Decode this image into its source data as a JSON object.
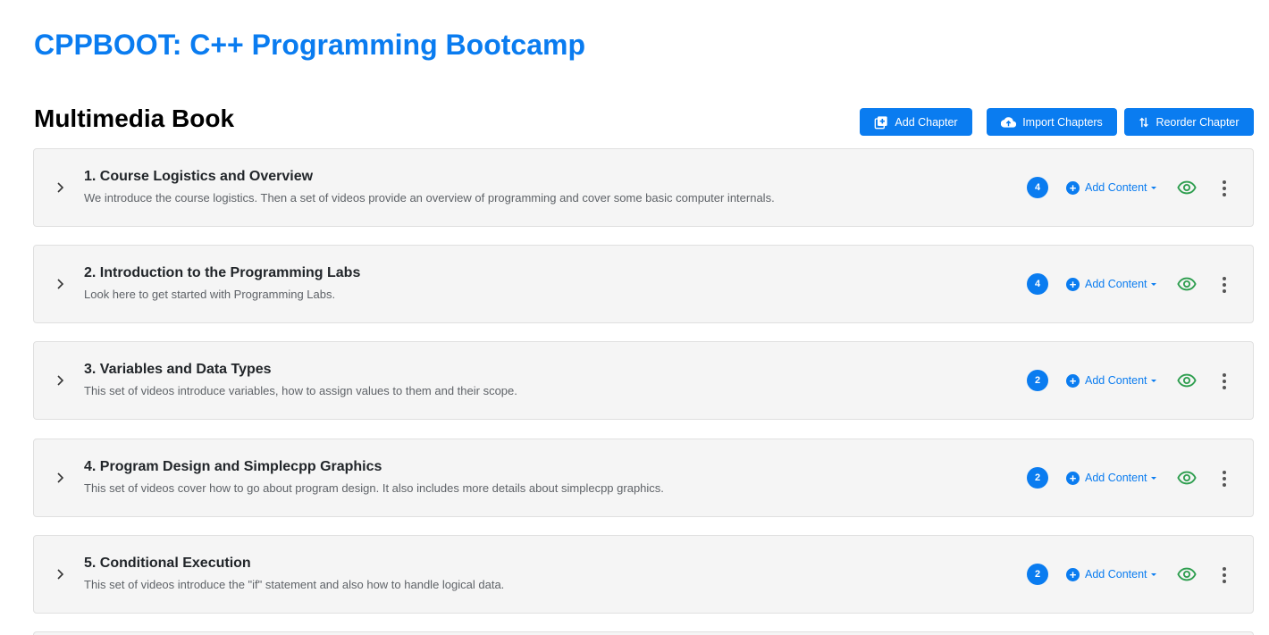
{
  "course": {
    "title": "CPPBOOT: C++ Programming Bootcamp"
  },
  "book": {
    "title": "Multimedia Book"
  },
  "toolbar": {
    "add_chapter": "Add Chapter",
    "import_chapters": "Import Chapters",
    "reorder_chapter": "Reorder Chapter"
  },
  "colors": {
    "accent": "#0a7cf0",
    "visible_eye": "#2e9e4f"
  },
  "icons": {
    "add_chapter": "library-add-icon",
    "import_chapters": "cloud-upload-icon",
    "reorder_chapter": "swap-vertical-icon",
    "expand": "chevron-right-icon",
    "add_content": "plus-circle-icon",
    "visibility": "eye-icon",
    "more": "more-vert-icon"
  },
  "chapters": [
    {
      "title": "1. Course Logistics and Overview",
      "description": "We introduce the course logistics. Then a set of videos provide an overview of programming and cover some basic computer internals.",
      "count": "4",
      "add_content_label": "Add Content"
    },
    {
      "title": "2. Introduction to the Programming Labs",
      "description": "Look here to get started with Programming Labs.",
      "count": "4",
      "add_content_label": "Add Content"
    },
    {
      "title": "3. Variables and Data Types",
      "description": "This set of videos introduce variables, how to assign values to them and their scope.",
      "count": "2",
      "add_content_label": "Add Content"
    },
    {
      "title": "4. Program Design and Simplecpp Graphics",
      "description": "This set of videos cover how to go about program design. It also includes more details about simplecpp graphics.",
      "count": "2",
      "add_content_label": "Add Content"
    },
    {
      "title": "5. Conditional Execution",
      "description": "This set of videos introduce the \"if\" statement and also how to handle logical data.",
      "count": "2",
      "add_content_label": "Add Content"
    }
  ]
}
